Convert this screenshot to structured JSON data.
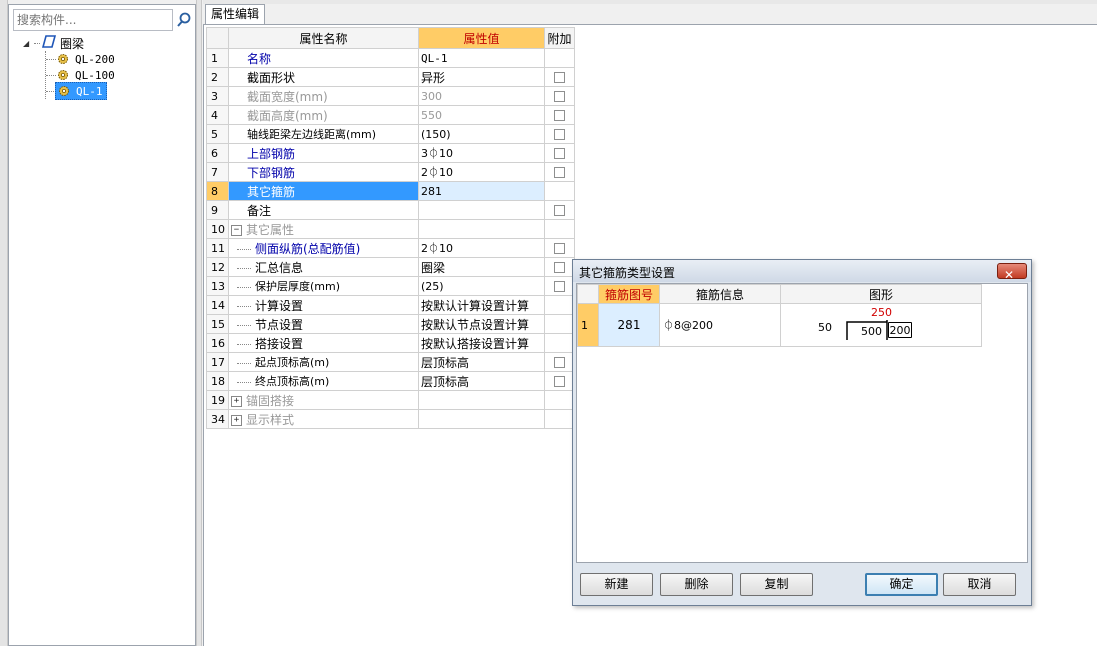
{
  "search": {
    "placeholder": "搜索构件..."
  },
  "tree": {
    "root": "圈梁",
    "items": [
      "QL-200",
      "QL-100",
      "QL-1"
    ],
    "selected": "QL-1"
  },
  "tab": {
    "label": "属性编辑"
  },
  "props": {
    "headers": {
      "name": "属性名称",
      "value": "属性值",
      "extra": "附加"
    },
    "rows": [
      {
        "num": "1",
        "name": "名称",
        "value": "QL-1"
      },
      {
        "num": "2",
        "name": "截面形状",
        "value": "异形"
      },
      {
        "num": "3",
        "name": "截面宽度(mm)",
        "value": "300"
      },
      {
        "num": "4",
        "name": "截面高度(mm)",
        "value": "550"
      },
      {
        "num": "5",
        "name": "轴线距梁左边线距离(mm)",
        "value": "(150)"
      },
      {
        "num": "6",
        "name": "上部钢筋",
        "value": "3⏀10"
      },
      {
        "num": "7",
        "name": "下部钢筋",
        "value": "2⏀10"
      },
      {
        "num": "8",
        "name": "其它箍筋",
        "value": "281"
      },
      {
        "num": "9",
        "name": "备注",
        "value": ""
      },
      {
        "num": "10",
        "name": "其它属性",
        "value": ""
      },
      {
        "num": "11",
        "name": "侧面纵筋(总配筋值)",
        "value": "2⏀10"
      },
      {
        "num": "12",
        "name": "汇总信息",
        "value": "圈梁"
      },
      {
        "num": "13",
        "name": "保护层厚度(mm)",
        "value": "(25)"
      },
      {
        "num": "14",
        "name": "计算设置",
        "value": "按默认计算设置计算"
      },
      {
        "num": "15",
        "name": "节点设置",
        "value": "按默认节点设置计算"
      },
      {
        "num": "16",
        "name": "搭接设置",
        "value": "按默认搭接设置计算"
      },
      {
        "num": "17",
        "name": "起点顶标高(m)",
        "value": "层顶标高"
      },
      {
        "num": "18",
        "name": "终点顶标高(m)",
        "value": "层顶标高"
      },
      {
        "num": "19",
        "name": "锚固搭接",
        "value": ""
      },
      {
        "num": "34",
        "name": "显示样式",
        "value": ""
      }
    ]
  },
  "dialog": {
    "title": "其它箍筋类型设置",
    "close": "✕",
    "headers": {
      "id": "箍筋图号",
      "info": "箍筋信息",
      "shape": "图形"
    },
    "row": {
      "num": "1",
      "id": "281",
      "info": "⏀8@200",
      "shape": {
        "top": "250",
        "left": "50",
        "mid": "500",
        "right": "200"
      }
    },
    "buttons": {
      "new": "新建",
      "delete": "删除",
      "copy": "复制",
      "ok": "确定",
      "cancel": "取消"
    }
  },
  "colors": {
    "accent": "#3399ff",
    "header_highlight": "#ffcc66",
    "header_text": "#c00000",
    "blue_text": "#0000aa",
    "dimension_red": "#d00000"
  }
}
